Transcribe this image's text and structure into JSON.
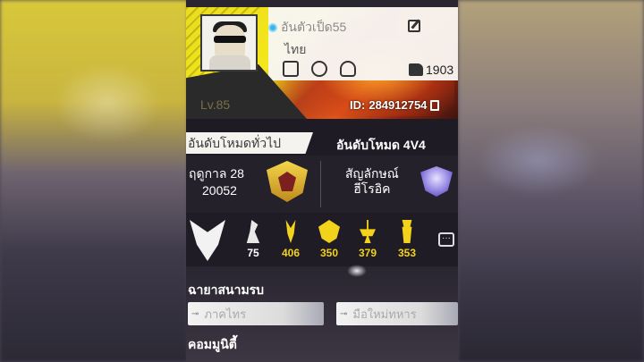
{
  "profile": {
    "nickname": "อันตัวเป็ด55",
    "country": "ไทย",
    "level": "Lv.85",
    "likes": "1903",
    "uid_label": "ID:",
    "uid_value": "284912754"
  },
  "rank": {
    "tab_br": "อันดับโหมดทั่วไป",
    "tab_cs": "อันดับโหมด 4V4",
    "br_rank_line1": "ฤดูกาล 28",
    "br_rank_line2": "20052",
    "cs_rank_line1": "สัญลักษณ์",
    "cs_rank_line2": "ฮีโรอิค"
  },
  "badges": [
    {
      "icon": "white-glyph-icon",
      "count": "75",
      "color": "#ffffff"
    },
    {
      "icon": "gold-glyph-icon",
      "count": "406",
      "color": "#f3d21b"
    },
    {
      "icon": "gold-crest-icon",
      "count": "350",
      "color": "#f3d21b"
    },
    {
      "icon": "gold-scale-icon",
      "count": "379",
      "color": "#f3d21b"
    },
    {
      "icon": "gold-trophy-icon",
      "count": "353",
      "color": "#f3d21b"
    }
  ],
  "sections": {
    "battle_title": "ฉายาสนามรบ",
    "community": "คอมมูนิตี้"
  },
  "title_fields": {
    "left": "ภาคไทร",
    "right": "มือใหม่ทหาร"
  },
  "colors": {
    "accent_yellow": "#f4e71a",
    "badge_gold": "#f3d21b",
    "verified_blue": "#3ab5e6"
  }
}
